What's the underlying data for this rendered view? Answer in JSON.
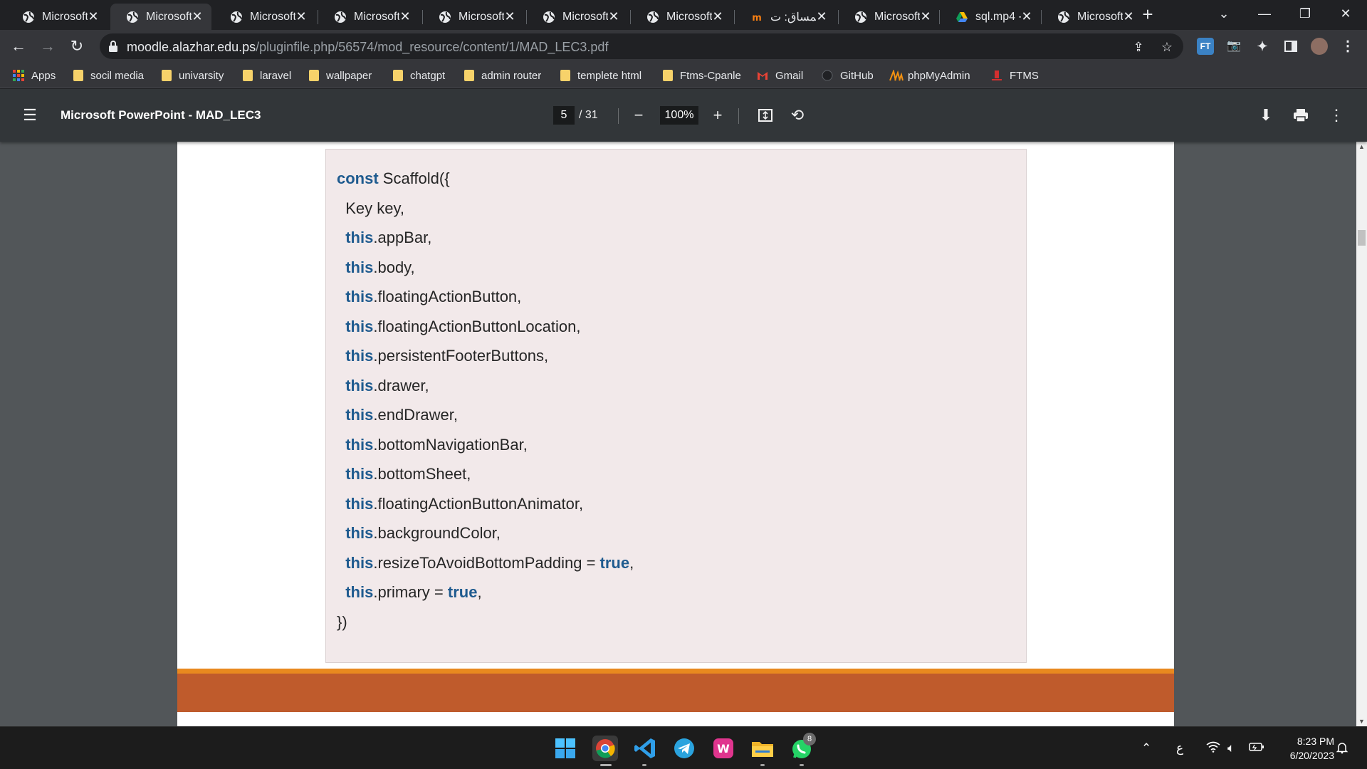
{
  "browser": {
    "tabs": [
      {
        "label": "Microsoft",
        "icon": "globe-icon"
      },
      {
        "label": "Microsoft",
        "icon": "globe-icon",
        "active": true
      },
      {
        "label": "Microsoft",
        "icon": "globe-icon"
      },
      {
        "label": "Microsoft",
        "icon": "globe-icon"
      },
      {
        "label": "Microsoft",
        "icon": "globe-icon"
      },
      {
        "label": "Microsoft",
        "icon": "globe-icon"
      },
      {
        "label": "Microsoft",
        "icon": "globe-icon"
      },
      {
        "label": "المساق: ت",
        "icon": "moodle-icon"
      },
      {
        "label": "Microsoft",
        "icon": "globe-icon"
      },
      {
        "label": "sql.mp4 -",
        "icon": "google-drive-icon"
      },
      {
        "label": "Microsoft",
        "icon": "globe-icon"
      }
    ],
    "tab_close_glyph": "✕",
    "new_tab_glyph": "+",
    "address": {
      "host": "moodle.alazhar.edu.ps",
      "path": "/pluginfile.php/56574/mod_resource/content/1/MAD_LEC3.pdf"
    },
    "bookmarks": [
      {
        "label": "Apps",
        "icon": "apps-grid-icon"
      },
      {
        "label": "socil media",
        "icon": "folder-icon"
      },
      {
        "label": "univarsity",
        "icon": "folder-icon"
      },
      {
        "label": "laravel",
        "icon": "folder-icon"
      },
      {
        "label": "wallpaper",
        "icon": "folder-icon"
      },
      {
        "label": "chatgpt",
        "icon": "folder-icon"
      },
      {
        "label": "admin router",
        "icon": "folder-icon"
      },
      {
        "label": "templete html",
        "icon": "folder-icon"
      },
      {
        "label": "Ftms-Cpanle",
        "icon": "folder-icon"
      },
      {
        "label": "Gmail",
        "icon": "gmail-icon"
      },
      {
        "label": "GitHub",
        "icon": "github-icon"
      },
      {
        "label": "phpMyAdmin",
        "icon": "phpmyadmin-icon"
      },
      {
        "label": "FTMS",
        "icon": "ftms-icon"
      }
    ],
    "extension_label": "FT"
  },
  "pdf_viewer": {
    "title": "Microsoft PowerPoint - MAD_LEC3",
    "current_page": "5",
    "page_total": "/ 31",
    "zoom": "100%"
  },
  "document": {
    "code_lines": [
      [
        {
          "t": "const",
          "kw": true
        },
        {
          "t": " Scaffold({"
        }
      ],
      [
        {
          "t": "  Key key,"
        }
      ],
      [
        {
          "t": "  "
        },
        {
          "t": "this",
          "kw": true
        },
        {
          "t": ".appBar,"
        }
      ],
      [
        {
          "t": "  "
        },
        {
          "t": "this",
          "kw": true
        },
        {
          "t": ".body,"
        }
      ],
      [
        {
          "t": "  "
        },
        {
          "t": "this",
          "kw": true
        },
        {
          "t": ".floatingActionButton,"
        }
      ],
      [
        {
          "t": "  "
        },
        {
          "t": "this",
          "kw": true
        },
        {
          "t": ".floatingActionButtonLocation,"
        }
      ],
      [
        {
          "t": "  "
        },
        {
          "t": "this",
          "kw": true
        },
        {
          "t": ".persistentFooterButtons,"
        }
      ],
      [
        {
          "t": "  "
        },
        {
          "t": "this",
          "kw": true
        },
        {
          "t": ".drawer,"
        }
      ],
      [
        {
          "t": "  "
        },
        {
          "t": "this",
          "kw": true
        },
        {
          "t": ".endDrawer,"
        }
      ],
      [
        {
          "t": "  "
        },
        {
          "t": "this",
          "kw": true
        },
        {
          "t": ".bottomNavigationBar,"
        }
      ],
      [
        {
          "t": "  "
        },
        {
          "t": "this",
          "kw": true
        },
        {
          "t": ".bottomSheet,"
        }
      ],
      [
        {
          "t": "  "
        },
        {
          "t": "this",
          "kw": true
        },
        {
          "t": ".floatingActionButtonAnimator,"
        }
      ],
      [
        {
          "t": "  "
        },
        {
          "t": "this",
          "kw": true
        },
        {
          "t": ".backgroundColor,"
        }
      ],
      [
        {
          "t": "  "
        },
        {
          "t": "this",
          "kw": true
        },
        {
          "t": ".resizeToAvoidBottomPadding = "
        },
        {
          "t": "true",
          "kw": true
        },
        {
          "t": ","
        }
      ],
      [
        {
          "t": "  "
        },
        {
          "t": "this",
          "kw": true
        },
        {
          "t": ".primary = "
        },
        {
          "t": "true",
          "kw": true
        },
        {
          "t": ","
        }
      ],
      [
        {
          "t": "})"
        }
      ]
    ],
    "keyword_color": "#1f5b8f",
    "code_background": "#f2e9ea",
    "footer_band_color": "#bf5b2c"
  },
  "taskbar": {
    "apps": [
      {
        "name": "windows-start-icon"
      },
      {
        "name": "chrome-icon",
        "running": true
      },
      {
        "name": "vscode-icon",
        "running": true
      },
      {
        "name": "telegram-icon"
      },
      {
        "name": "wampserver-icon"
      },
      {
        "name": "file-explorer-icon",
        "running": true
      },
      {
        "name": "whatsapp-icon",
        "running": true,
        "badge": "8"
      }
    ],
    "tray_language": "ع",
    "time": "8:23 PM",
    "date": "6/20/2023"
  }
}
